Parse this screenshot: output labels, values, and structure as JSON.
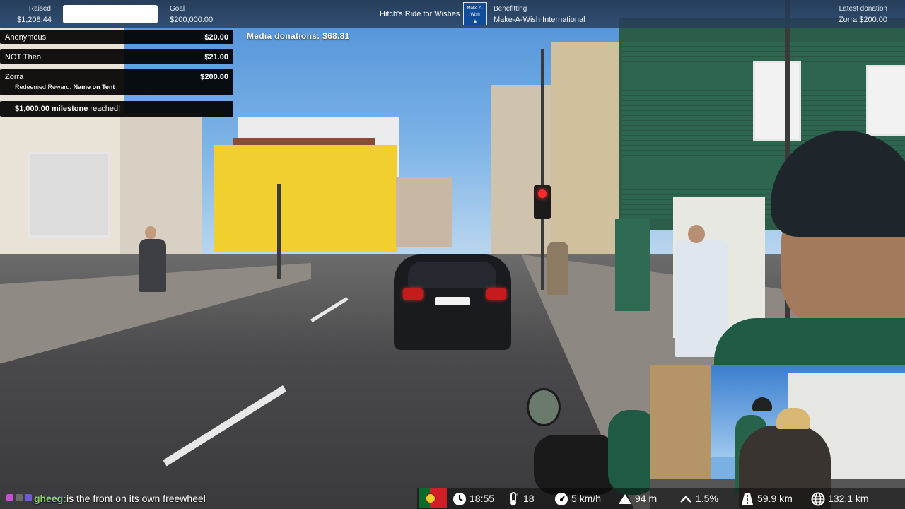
{
  "topbar": {
    "raised_label": "Raised",
    "raised_value": "$1,208.44",
    "goal_label": "Goal",
    "goal_value": "$200,000.00",
    "title": "Hitch's Ride for Wishes",
    "logo_text": "Make-A-Wish",
    "benefitting_label": "Benefitting",
    "benefitting_value": "Make-A-Wish International",
    "latest_label": "Latest donation",
    "latest_value": "Zorra $200.00"
  },
  "donations": [
    {
      "name": "Anonymous",
      "amount": "$20.00"
    },
    {
      "name": "NOT Theo",
      "amount": "$21.00"
    },
    {
      "name": "Zorra",
      "amount": "$200.00",
      "reward_prefix": "Redeemed Reward:",
      "reward_name": "Name on Tent"
    }
  ],
  "milestone": {
    "amount": "$1,000.00 milestone",
    "suffix": "reached!"
  },
  "media_donations": "Media donations: $68.81",
  "chat": {
    "user": "gheeg:",
    "message": "is the front on its own freewheel"
  },
  "stats": {
    "time": "18:55",
    "temperature": "18",
    "speed": "5 km/h",
    "altitude": "94 m",
    "grade": "1.5%",
    "distance": "59.9 km",
    "total_distance": "132.1 km"
  },
  "colors": {
    "chat_user": "#8bd36a",
    "alert_bg": "#000000",
    "topbar_bg": "#25384f",
    "logo_bg": "#0f4c9a"
  }
}
